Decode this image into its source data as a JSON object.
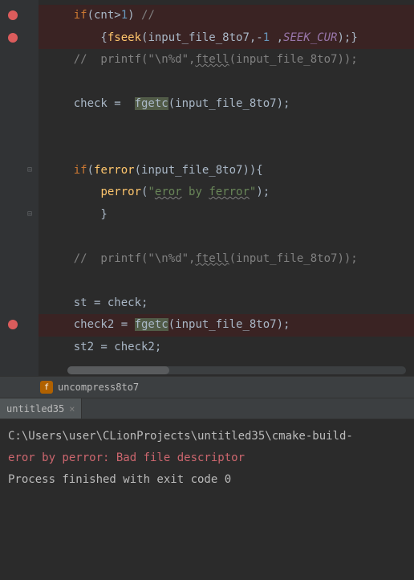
{
  "code": {
    "lines": [
      {
        "bp": true,
        "html": "<span class='kw'>if</span>(cnt&gt;<span class='num'>1</span>) <span class='cm'>//</span>"
      },
      {
        "bp": true,
        "html": "    {<span class='fn'>fseek</span>(input_file_8to7,-<span class='num'>1</span> ,<span class='const'>SEEK_CUR</span>);}"
      },
      {
        "bp": false,
        "html": "<span class='cm'>//  printf(\"\\n%d\",</span><span class='cm underline'>ftell</span><span class='cm'>(input_file_8to7));</span>"
      },
      {
        "bp": false,
        "html": ""
      },
      {
        "bp": false,
        "html": "check =  <span class='highlight'>fgetc</span>(input_file_8to7);"
      },
      {
        "bp": false,
        "html": ""
      },
      {
        "bp": false,
        "html": ""
      },
      {
        "bp": false,
        "html": "<span class='kw'>if</span>(<span class='fn'>ferror</span>(input_file_8to7)){"
      },
      {
        "bp": false,
        "html": "    <span class='fn'>perror</span>(<span class='str'>\"</span><span class='str underline'>eror</span><span class='str'> by </span><span class='str underline'>ferror</span><span class='str'>\"</span>);"
      },
      {
        "bp": false,
        "html": "    }"
      },
      {
        "bp": false,
        "html": ""
      },
      {
        "bp": false,
        "html": "<span class='cm'>//  printf(\"\\n%d\",</span><span class='cm underline'>ftell</span><span class='cm'>(input_file_8to7));</span>"
      },
      {
        "bp": false,
        "html": ""
      },
      {
        "bp": false,
        "html": "st = check;"
      },
      {
        "bp": true,
        "html": "check2 = <span class='highlight'>fgetc</span>(input_file_8to7);"
      },
      {
        "bp": false,
        "html": "st2 = check2;"
      }
    ],
    "breakpoints": [
      0,
      1,
      14
    ],
    "fold_markers": [
      7,
      9
    ]
  },
  "breadcrumb": {
    "icon_letter": "f",
    "function_name": "uncompress8to7"
  },
  "console": {
    "tab_name": "untitled35",
    "output": [
      {
        "cls": "console-line",
        "text": "C:\\Users\\user\\CLionProjects\\untitled35\\cmake-build-"
      },
      {
        "cls": "console-line err-line",
        "text": "eror by perror: Bad file descriptor"
      },
      {
        "cls": "console-line",
        "text": ""
      },
      {
        "cls": "console-line",
        "text": "Process finished with exit code 0"
      }
    ]
  }
}
